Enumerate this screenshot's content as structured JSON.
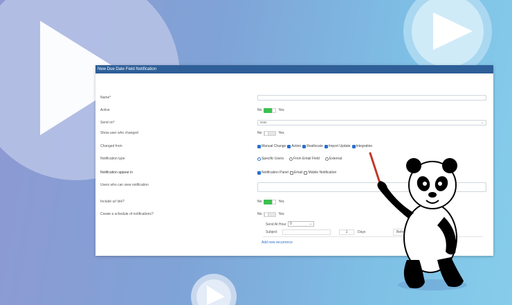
{
  "colors": {
    "header": "#2e5f98",
    "toggle_on": "#3cc04f",
    "checkbox": "#2a6fd0"
  },
  "modal": {
    "title": "New Due Date Field Notification",
    "fields": {
      "name": {
        "label": "Name*",
        "value": ""
      },
      "active": {
        "label": "Active",
        "no": "No",
        "yes": "Yes",
        "state": "on"
      },
      "send_on": {
        "label": "Send on*",
        "value": "Date"
      },
      "show_user": {
        "label": "Show user who changed",
        "no": "No",
        "yes": "Yes",
        "state": "off"
      },
      "changed_from": {
        "label": "Changed from",
        "options": [
          "Manual Change",
          "Action",
          "Reallocate",
          "Import Update",
          "Integration"
        ]
      },
      "notification_type": {
        "label": "Notification type",
        "options": [
          "Specific Users",
          "From Email Field",
          "External"
        ],
        "selected": "Specific Users"
      },
      "appear_in": {
        "label": "Notification appear in",
        "options": [
          "Notification Panel",
          "Email",
          "Mobile Notification"
        ],
        "checked": [
          "Notification Panel"
        ]
      },
      "users_view": {
        "label": "Users who can view notification"
      },
      "include_url": {
        "label": "Include url link?",
        "no": "No",
        "yes": "Yes",
        "state": "on"
      },
      "schedule": {
        "label": "Create a schedule of notifications?",
        "no": "No",
        "yes": "Yes",
        "state": "off"
      }
    },
    "schedule_block": {
      "send_at_hour_label": "Send At Hour",
      "send_at_hour_value": "0",
      "subject_label": "Subject",
      "days_value": "1",
      "days_label": "Days",
      "before_label": "Before",
      "add_link": "Add new recurrence"
    }
  }
}
